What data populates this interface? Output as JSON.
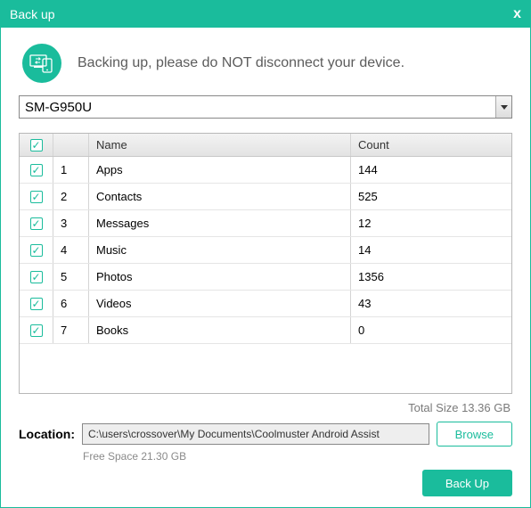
{
  "window": {
    "title": "Back up"
  },
  "banner": {
    "message": "Backing up, please do NOT disconnect your device."
  },
  "device": {
    "selected": "SM-G950U"
  },
  "table": {
    "headers": {
      "name": "Name",
      "count": "Count"
    },
    "rows": [
      {
        "num": "1",
        "name": "Apps",
        "count": "144",
        "checked": true
      },
      {
        "num": "2",
        "name": "Contacts",
        "count": "525",
        "checked": true
      },
      {
        "num": "3",
        "name": "Messages",
        "count": "12",
        "checked": true
      },
      {
        "num": "4",
        "name": "Music",
        "count": "14",
        "checked": true
      },
      {
        "num": "5",
        "name": "Photos",
        "count": "1356",
        "checked": true
      },
      {
        "num": "6",
        "name": "Videos",
        "count": "43",
        "checked": true
      },
      {
        "num": "7",
        "name": "Books",
        "count": "0",
        "checked": true
      }
    ],
    "all_checked": true
  },
  "total": {
    "text": "Total Size 13.36 GB"
  },
  "location": {
    "label": "Location:",
    "path": "C:\\users\\crossover\\My Documents\\Coolmuster Android Assist",
    "browse_label": "Browse",
    "free_space": "Free Space 21.30 GB"
  },
  "footer": {
    "backup_label": "Back Up"
  }
}
